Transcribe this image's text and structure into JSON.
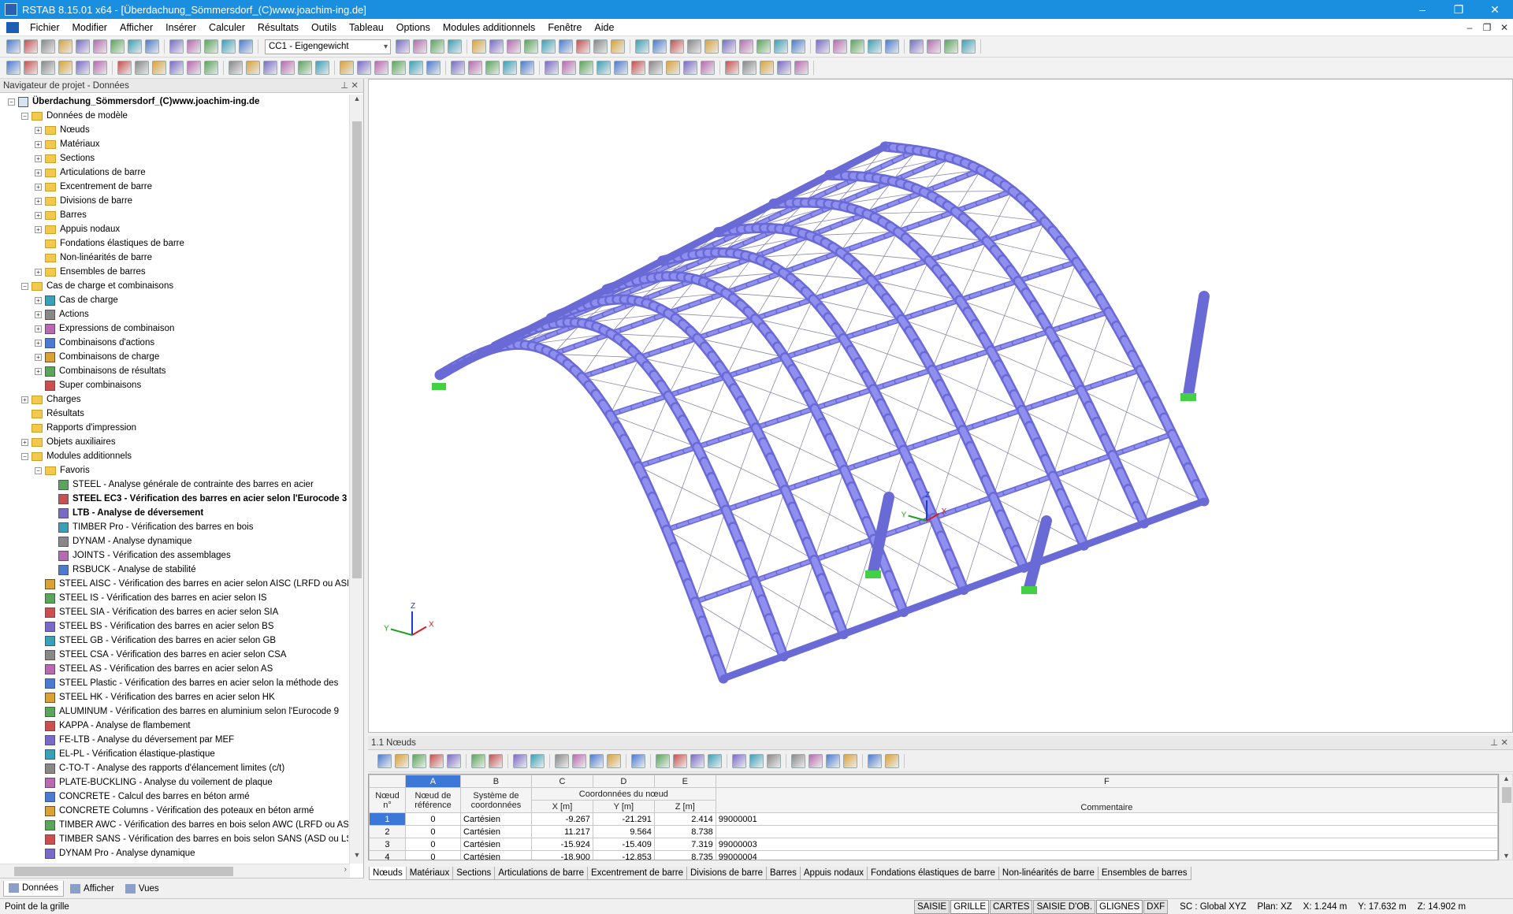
{
  "window": {
    "title": "RSTAB 8.15.01 x64 - [Überdachung_Sömmersdorf_(C)www.joachim-ing.de]",
    "minimize": "–",
    "maximize": "❐",
    "close": "✕"
  },
  "menu": [
    {
      "label": "Fichier",
      "ul": "F",
      "rest": "ichier"
    },
    {
      "label": "Modifier",
      "ul": "M",
      "rest": "odifier"
    },
    {
      "label": "Afficher",
      "ul": "A",
      "rest": "fficher"
    },
    {
      "label": "Insérer",
      "ul": "I",
      "rest": "nsérer"
    },
    {
      "label": "Calculer",
      "ul": "C",
      "rest": "alculer"
    },
    {
      "label": "Résultats",
      "ul": "R",
      "rest": "ésultats"
    },
    {
      "label": "Outils",
      "ul": "O",
      "rest": "utils"
    },
    {
      "label": "Tableau",
      "ul": "T",
      "rest": "ableau"
    },
    {
      "label": "Options",
      "ul": "p",
      "rest": "tions"
    },
    {
      "label": "Modules additionnels",
      "ul": "",
      "rest": ""
    },
    {
      "label": "Fenêtre",
      "ul": "F",
      "rest": "enêtre"
    },
    {
      "label": "Aide",
      "ul": "A",
      "rest": "ide"
    }
  ],
  "toolbar": {
    "load_case_combo": "CC1 - Eigengewicht"
  },
  "navigator": {
    "header": "Navigateur de projet - Données",
    "pin": "⊥ ✕",
    "project": "Überdachung_Sömmersdorf_(C)www.joachim-ing.de",
    "rows": [
      {
        "level": 1,
        "tog": "−",
        "icon": "folder",
        "label": "Données de modèle"
      },
      {
        "level": 2,
        "tog": "+",
        "icon": "folder",
        "label": "Nœuds"
      },
      {
        "level": 2,
        "tog": "+",
        "icon": "folder",
        "label": "Matériaux"
      },
      {
        "level": 2,
        "tog": "+",
        "icon": "folder",
        "label": "Sections"
      },
      {
        "level": 2,
        "tog": "+",
        "icon": "folder",
        "label": "Articulations de barre"
      },
      {
        "level": 2,
        "tog": "+",
        "icon": "folder",
        "label": "Excentrement de barre"
      },
      {
        "level": 2,
        "tog": "+",
        "icon": "folder",
        "label": "Divisions de barre"
      },
      {
        "level": 2,
        "tog": "+",
        "icon": "folder",
        "label": "Barres"
      },
      {
        "level": 2,
        "tog": "+",
        "icon": "folder",
        "label": "Appuis nodaux"
      },
      {
        "level": 2,
        "tog": "",
        "icon": "folder",
        "label": "Fondations élastiques de barre"
      },
      {
        "level": 2,
        "tog": "",
        "icon": "folder",
        "label": "Non-linéarités de barre"
      },
      {
        "level": 2,
        "tog": "+",
        "icon": "folder",
        "label": "Ensembles de barres"
      },
      {
        "level": 1,
        "tog": "−",
        "icon": "folder",
        "label": "Cas de charge et combinaisons"
      },
      {
        "level": 2,
        "tog": "+",
        "icon": "module",
        "label": "Cas de charge"
      },
      {
        "level": 2,
        "tog": "+",
        "icon": "module",
        "label": "Actions"
      },
      {
        "level": 2,
        "tog": "+",
        "icon": "module",
        "label": "Expressions de combinaison"
      },
      {
        "level": 2,
        "tog": "+",
        "icon": "module",
        "label": "Combinaisons d'actions"
      },
      {
        "level": 2,
        "tog": "+",
        "icon": "module",
        "label": "Combinaisons de charge"
      },
      {
        "level": 2,
        "tog": "+",
        "icon": "module",
        "label": "Combinaisons de résultats"
      },
      {
        "level": 2,
        "tog": "",
        "icon": "module",
        "label": "Super combinaisons"
      },
      {
        "level": 1,
        "tog": "+",
        "icon": "folder",
        "label": "Charges"
      },
      {
        "level": 1,
        "tog": "",
        "icon": "folder",
        "label": "Résultats"
      },
      {
        "level": 1,
        "tog": "",
        "icon": "folder",
        "label": "Rapports d'impression"
      },
      {
        "level": 1,
        "tog": "+",
        "icon": "folder",
        "label": "Objets auxiliaires"
      },
      {
        "level": 1,
        "tog": "−",
        "icon": "folder",
        "label": "Modules additionnels"
      },
      {
        "level": 2,
        "tog": "−",
        "icon": "folder",
        "label": "Favoris"
      },
      {
        "level": 3,
        "tog": "",
        "icon": "module",
        "label": "STEEL - Analyse générale de contrainte des barres en acier"
      },
      {
        "level": 3,
        "tog": "",
        "icon": "module",
        "label": "STEEL EC3 - Vérification des barres en acier selon l'Eurocode 3",
        "bold": true
      },
      {
        "level": 3,
        "tog": "",
        "icon": "module",
        "label": "LTB - Analyse de déversement",
        "bold": true
      },
      {
        "level": 3,
        "tog": "",
        "icon": "module",
        "label": "TIMBER Pro - Vérification des barres en bois"
      },
      {
        "level": 3,
        "tog": "",
        "icon": "module",
        "label": "DYNAM - Analyse dynamique"
      },
      {
        "level": 3,
        "tog": "",
        "icon": "module",
        "label": "JOINTS - Vérification des assemblages"
      },
      {
        "level": 3,
        "tog": "",
        "icon": "module",
        "label": "RSBUCK - Analyse de stabilité"
      },
      {
        "level": 2,
        "tog": "",
        "icon": "module",
        "label": "STEEL AISC - Vérification des barres en acier selon AISC (LRFD ou ASD)"
      },
      {
        "level": 2,
        "tog": "",
        "icon": "module",
        "label": "STEEL IS - Vérification des barres en acier selon IS"
      },
      {
        "level": 2,
        "tog": "",
        "icon": "module",
        "label": "STEEL SIA - Vérification des barres en acier selon SIA"
      },
      {
        "level": 2,
        "tog": "",
        "icon": "module",
        "label": "STEEL BS - Vérification des barres en acier selon BS"
      },
      {
        "level": 2,
        "tog": "",
        "icon": "module",
        "label": "STEEL GB - Vérification des barres en acier selon GB"
      },
      {
        "level": 2,
        "tog": "",
        "icon": "module",
        "label": "STEEL CSA - Vérification des barres en acier selon CSA"
      },
      {
        "level": 2,
        "tog": "",
        "icon": "module",
        "label": "STEEL AS - Vérification des barres en acier selon AS"
      },
      {
        "level": 2,
        "tog": "",
        "icon": "module",
        "label": "STEEL Plastic - Vérification des barres en acier selon la méthode des"
      },
      {
        "level": 2,
        "tog": "",
        "icon": "module",
        "label": "STEEL HK - Vérification des barres en acier selon HK"
      },
      {
        "level": 2,
        "tog": "",
        "icon": "module",
        "label": "ALUMINUM - Vérification des barres en aluminium selon l'Eurocode 9"
      },
      {
        "level": 2,
        "tog": "",
        "icon": "module",
        "label": "KAPPA - Analyse de flambement"
      },
      {
        "level": 2,
        "tog": "",
        "icon": "module",
        "label": "FE-LTB - Analyse du déversement par MEF"
      },
      {
        "level": 2,
        "tog": "",
        "icon": "module",
        "label": "EL-PL - Vérification élastique-plastique"
      },
      {
        "level": 2,
        "tog": "",
        "icon": "module",
        "label": "C-TO-T - Analyse des rapports d'élancement limites (c/t)"
      },
      {
        "level": 2,
        "tog": "",
        "icon": "module",
        "label": "PLATE-BUCKLING - Analyse du voilement de plaque"
      },
      {
        "level": 2,
        "tog": "",
        "icon": "module",
        "label": "CONCRETE - Calcul des barres en béton armé"
      },
      {
        "level": 2,
        "tog": "",
        "icon": "module",
        "label": "CONCRETE Columns - Vérification des poteaux en béton armé"
      },
      {
        "level": 2,
        "tog": "",
        "icon": "module",
        "label": "TIMBER AWC - Vérification des barres en bois selon AWC (LRFD ou ASD)"
      },
      {
        "level": 2,
        "tog": "",
        "icon": "module",
        "label": "TIMBER SANS - Vérification des barres en bois selon SANS (ASD ou LSD)"
      },
      {
        "level": 2,
        "tog": "",
        "icon": "module",
        "label": "DYNAM Pro - Analyse dynamique"
      }
    ],
    "tabs": [
      "Données",
      "Afficher",
      "Vues"
    ]
  },
  "view": {
    "axes_main": {
      "x": "X",
      "y": "Y",
      "z": "Z"
    },
    "axes_corner": {
      "x": "X",
      "y": "Y",
      "z": "Z"
    }
  },
  "table": {
    "header": "1.1 Nœuds",
    "pin": "⊥ ✕",
    "col_letters": [
      "A",
      "B",
      "C",
      "D",
      "E",
      "F"
    ],
    "col_group_coords": "Coordonnées du nœud",
    "col_heads": {
      "node_no": "Nœud n°",
      "ref": "Nœud de référence",
      "system": "Système de coordonnées",
      "x": "X [m]",
      "y": "Y [m]",
      "z": "Z [m]",
      "comment": "Commentaire"
    },
    "rows": [
      {
        "no": "1",
        "ref": "0",
        "sys": "Cartésien",
        "x": "-9.267",
        "y": "-21.291",
        "z": "2.414",
        "comment": "99000001"
      },
      {
        "no": "2",
        "ref": "0",
        "sys": "Cartésien",
        "x": "11.217",
        "y": "9.564",
        "z": "8.738",
        "comment": ""
      },
      {
        "no": "3",
        "ref": "0",
        "sys": "Cartésien",
        "x": "-15.924",
        "y": "-15.409",
        "z": "7.319",
        "comment": "99000003"
      },
      {
        "no": "4",
        "ref": "0",
        "sys": "Cartésien",
        "x": "-18.900",
        "y": "-12.853",
        "z": "8.735",
        "comment": "99000004"
      }
    ],
    "tabs": [
      "Nœuds",
      "Matériaux",
      "Sections",
      "Articulations de barre",
      "Excentrement de barre",
      "Divisions de barre",
      "Barres",
      "Appuis nodaux",
      "Fondations élastiques de barre",
      "Non-linéarités de barre",
      "Ensembles de barres"
    ]
  },
  "status": {
    "hint": "Point de la grille",
    "toggles": [
      {
        "label": "SAISIE",
        "on": false
      },
      {
        "label": "GRILLE",
        "on": true
      },
      {
        "label": "CARTES",
        "on": false
      },
      {
        "label": "SAISIE D'OB.",
        "on": false
      },
      {
        "label": "GLIGNES",
        "on": true
      },
      {
        "label": "DXF",
        "on": false
      }
    ],
    "cs": "SC : Global XYZ",
    "plane": "Plan: XZ",
    "x": "X:  1.244 m",
    "y": "Y:  17.632 m",
    "z": "Z:  14.902 m"
  },
  "colors": {
    "titlebar": "#1a8fe0",
    "structure": "#8f8ff0",
    "structure_dark": "#6a6ad6",
    "support": "#44d044",
    "selection": "#3b78d8"
  }
}
